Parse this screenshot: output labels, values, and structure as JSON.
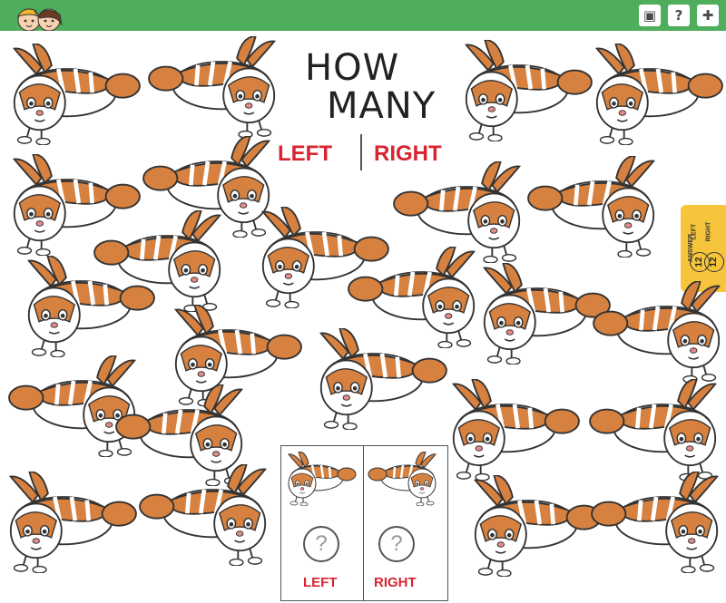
{
  "title": {
    "line1": "HOW",
    "line2": "MANY"
  },
  "directions": {
    "left": "LEFT",
    "right": "RIGHT"
  },
  "answer_tab": {
    "label": "ANSWER",
    "left_count": "12",
    "left_label": "LEFT",
    "right_count": "12",
    "right_label": "RIGHT"
  },
  "answer_box": {
    "question_mark": "?",
    "left_label": "LEFT",
    "right_label": "RIGHT"
  },
  "toolbar_icons": [
    "kids-logo-icon",
    "maze-icon",
    "question-icon",
    "puzzle-piece-icon"
  ],
  "colors": {
    "header_green": "#4fae5c",
    "accent_red": "#d8242f",
    "answer_tab_yellow": "#f6c53c",
    "rabbit_orange": "#d6813f"
  },
  "rabbits": [
    {
      "dir": "left"
    },
    {
      "dir": "right"
    },
    {
      "dir": "left"
    },
    {
      "dir": "left"
    },
    {
      "dir": "left"
    },
    {
      "dir": "right"
    },
    {
      "dir": "right"
    },
    {
      "dir": "right"
    },
    {
      "dir": "right"
    },
    {
      "dir": "left"
    },
    {
      "dir": "right"
    },
    {
      "dir": "left"
    },
    {
      "dir": "left"
    },
    {
      "dir": "left"
    },
    {
      "dir": "right"
    },
    {
      "dir": "left"
    },
    {
      "dir": "right"
    },
    {
      "dir": "right"
    },
    {
      "dir": "left"
    },
    {
      "dir": "right"
    },
    {
      "dir": "left"
    },
    {
      "dir": "right"
    },
    {
      "dir": "left"
    },
    {
      "dir": "right"
    }
  ]
}
